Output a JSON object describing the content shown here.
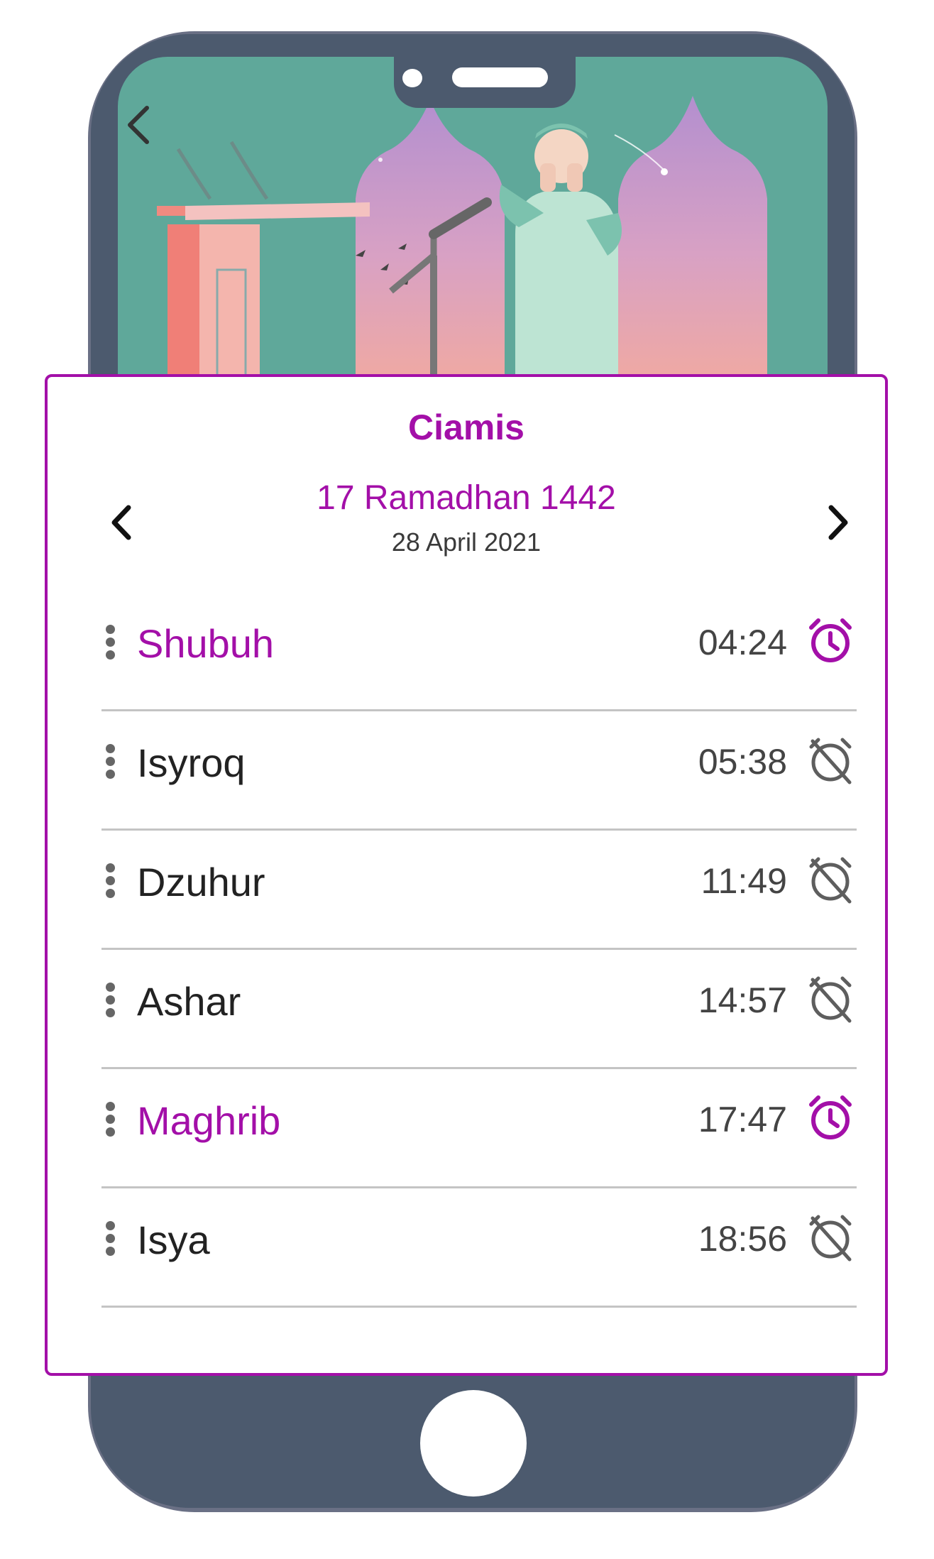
{
  "colors": {
    "accent": "#a30fa8",
    "alarm_on": "#a30fa8",
    "alarm_off": "#5e5e5e",
    "phone_body": "#6a7085",
    "art_bg": "#5fa89a"
  },
  "location": {
    "city": "Ciamis"
  },
  "date": {
    "hijri": "17 Ramadhan 1442",
    "gregorian": "28 April 2021",
    "prev_icon": "chevron-left-icon",
    "next_icon": "chevron-right-icon"
  },
  "prayers": [
    {
      "name": "Shubuh",
      "time": "04:24",
      "alarm": true,
      "highlight": true
    },
    {
      "name": "Isyroq",
      "time": "05:38",
      "alarm": false,
      "highlight": false
    },
    {
      "name": "Dzuhur",
      "time": "11:49",
      "alarm": false,
      "highlight": false
    },
    {
      "name": "Ashar",
      "time": "14:57",
      "alarm": false,
      "highlight": false
    },
    {
      "name": "Maghrib",
      "time": "17:47",
      "alarm": true,
      "highlight": true
    },
    {
      "name": "Isya",
      "time": "18:56",
      "alarm": false,
      "highlight": false
    }
  ]
}
